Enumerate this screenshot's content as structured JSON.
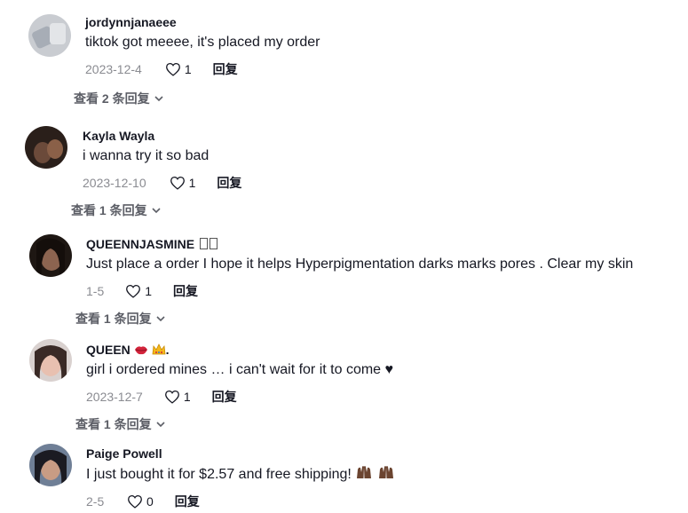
{
  "comments": [
    {
      "username": "jordynnjanaeee",
      "text": "tiktok got meeee, it's placed my order",
      "date": "2023-12-4",
      "likes": "1",
      "reply_label": "回复",
      "view_replies": "查看 2 条回复"
    },
    {
      "username": "Kayla Wayla",
      "text": "i wanna try it so bad",
      "date": "2023-12-10",
      "likes": "1",
      "reply_label": "回复",
      "view_replies": "查看 1 条回复"
    },
    {
      "username": "QUEENNJASMINE",
      "text": "Just place a order I hope it helps Hyperpigmentation darks marks pores . Clear my skin",
      "date": "1-5",
      "likes": "1",
      "reply_label": "回复",
      "view_replies": "查看 1 条回复"
    },
    {
      "username": "QUEEN",
      "username_suffix": ".",
      "text": "girl i ordered mines … i can't wait for it to come ♥",
      "date": "2023-12-7",
      "likes": "1",
      "reply_label": "回复",
      "view_replies": "查看 1 条回复"
    },
    {
      "username": "Paige Powell",
      "text": "I just bought it for $2.57 and free shipping!",
      "date": "2-5",
      "likes": "0",
      "reply_label": "回复"
    }
  ],
  "icons": {
    "heart": "heart-outline-icon",
    "chevron": "chevron-down-icon",
    "lips": "lips-emoji-icon",
    "crown": "crown-emoji-icon",
    "hands": "raised-hands-emoji-icon"
  },
  "colors": {
    "text": "#161823",
    "muted": "#8a8b91",
    "view_replies": "#5c5e66"
  }
}
